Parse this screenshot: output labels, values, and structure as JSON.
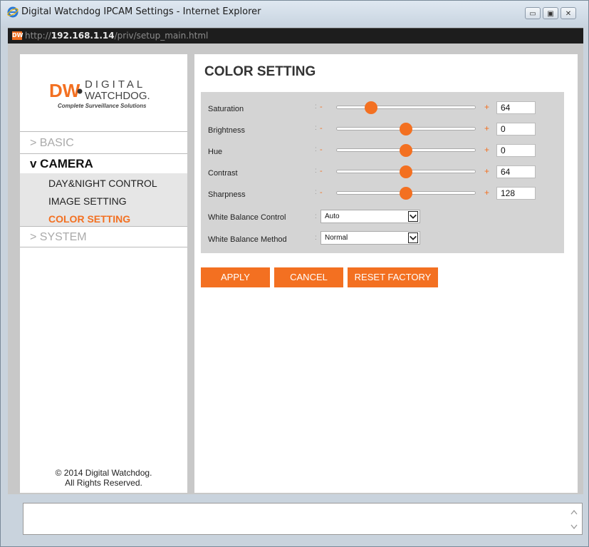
{
  "window": {
    "title": "Digital Watchdog IPCAM Settings - Internet Explorer",
    "address_prefix": "http://",
    "address_host": "192.168.1.14",
    "address_path": "/priv/setup_main.html",
    "minimize": "▭",
    "maximize": "▣",
    "close": "✕"
  },
  "brand": {
    "logo_mark": "DW",
    "logo_line1": "DIGITAL",
    "logo_line2": "WATCHDOG.",
    "tagline": "Complete Surveillance Solutions",
    "accent_color": "#f37021"
  },
  "sidebar": {
    "basic": "> BASIC",
    "camera": "v CAMERA",
    "camera_items": [
      "DAY&NIGHT CONTROL",
      "IMAGE SETTING",
      "COLOR SETTING"
    ],
    "system": "> SYSTEM",
    "copyright_line1": "© 2014 Digital Watchdog.",
    "copyright_line2": "All Rights Reserved."
  },
  "main": {
    "title": "COLOR SETTING",
    "minus": "-",
    "plus": "+",
    "colon": ":",
    "sliders": [
      {
        "label": "Saturation",
        "value": "64",
        "level": 0.25
      },
      {
        "label": "Brightness",
        "value": "0",
        "level": 0.5
      },
      {
        "label": "Hue",
        "value": "0",
        "level": 0.5
      },
      {
        "label": "Contrast",
        "value": "64",
        "level": 0.5
      },
      {
        "label": "Sharpness",
        "value": "128",
        "level": 0.5
      }
    ],
    "white_balance_control": {
      "label": "White Balance Control",
      "value": "Auto"
    },
    "white_balance_method": {
      "label": "White Balance Method",
      "value": "Normal"
    },
    "buttons": {
      "apply": "APPLY",
      "cancel": "CANCEL",
      "reset": "RESET FACTORY"
    }
  }
}
